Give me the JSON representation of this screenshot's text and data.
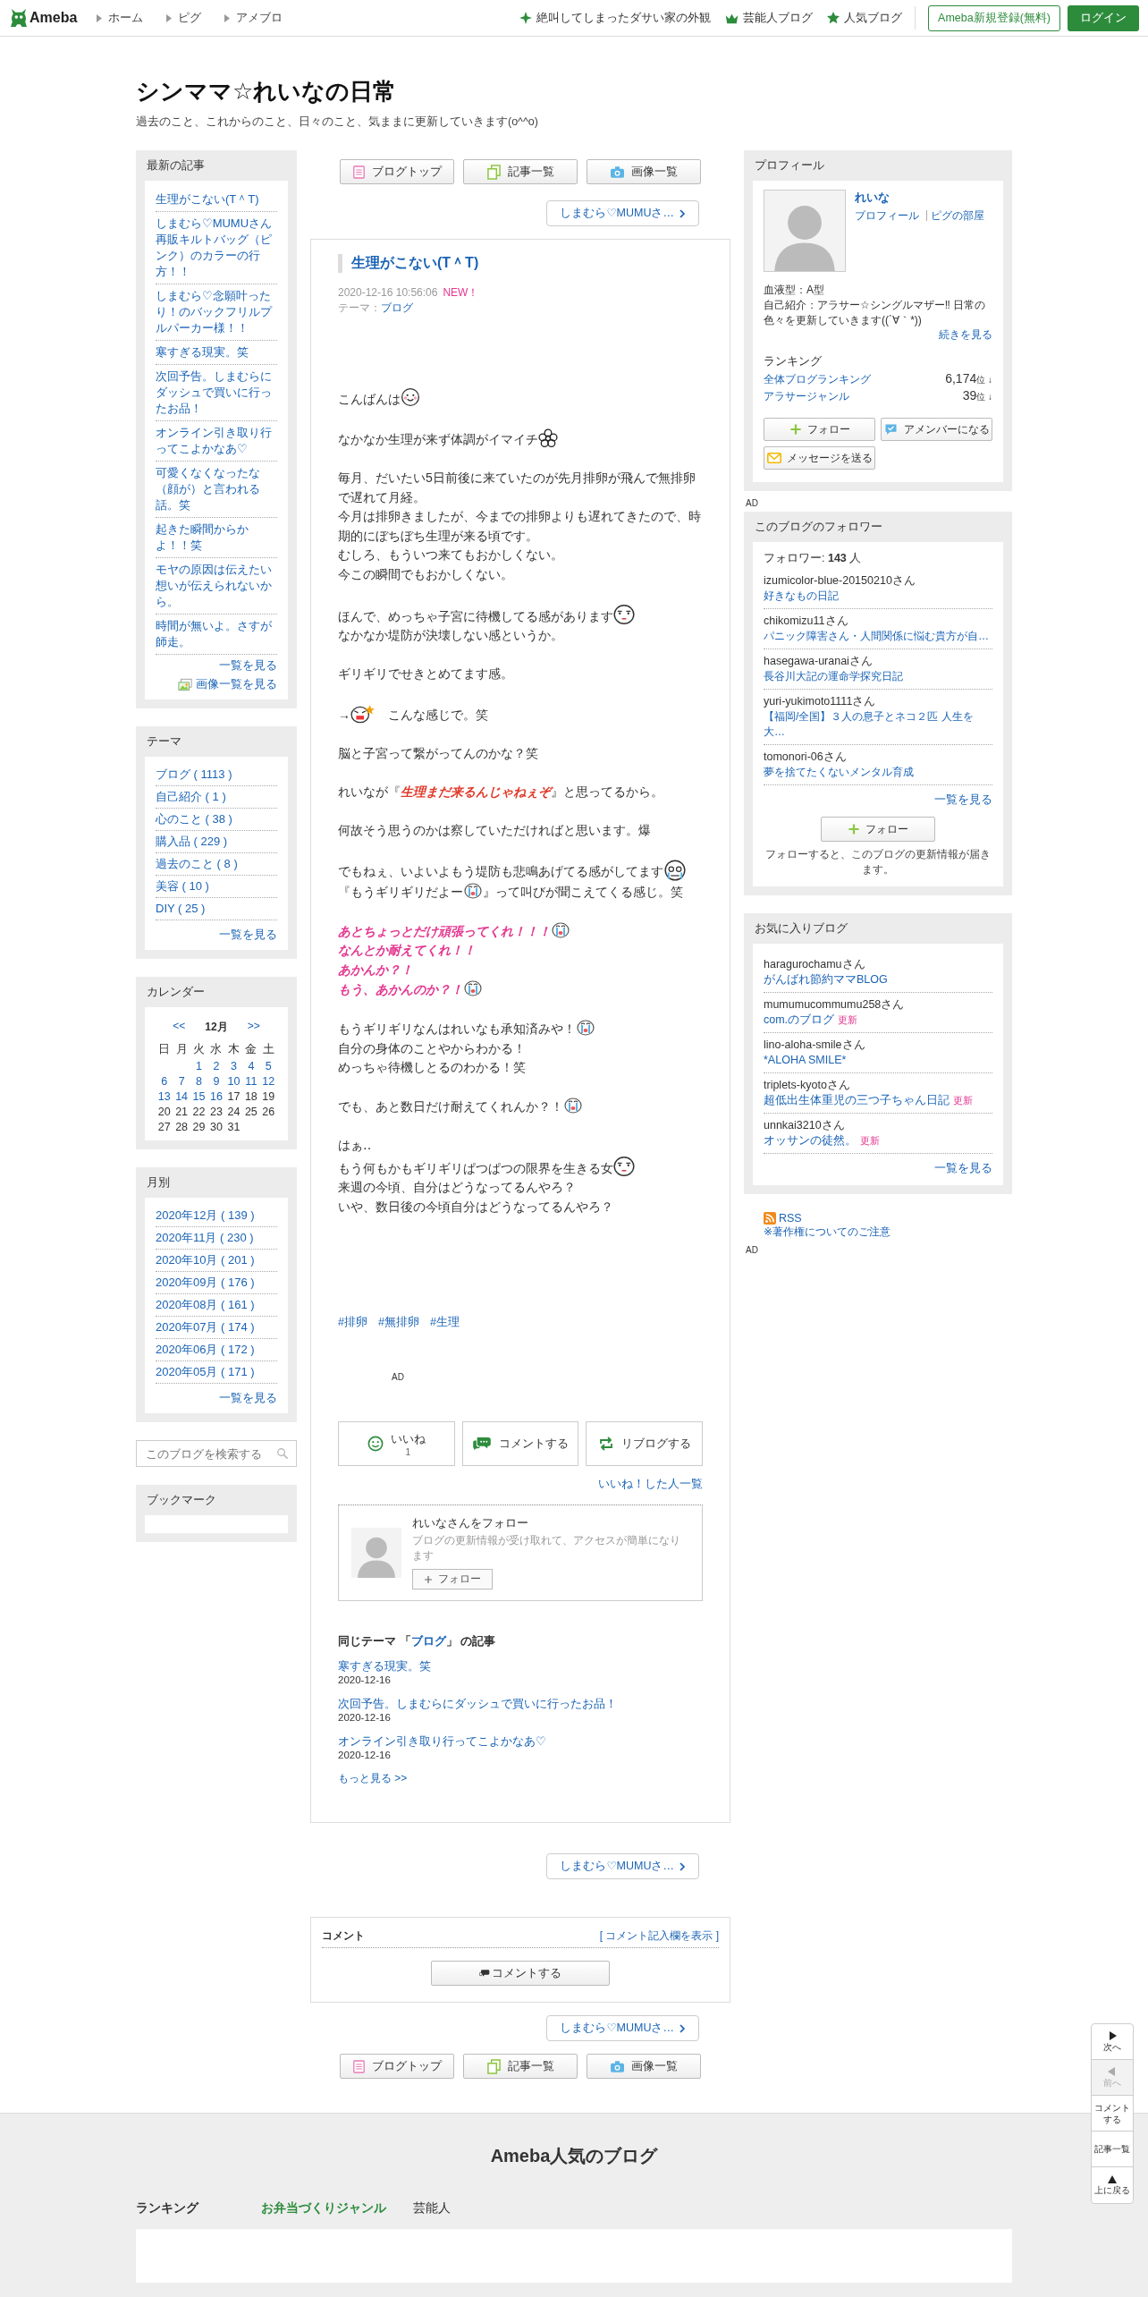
{
  "header": {
    "logo": "Ameba",
    "nav": [
      "ホーム",
      "ピグ",
      "アメブロ"
    ],
    "links": [
      {
        "kind": "sparkle",
        "label": "絶叫してしまったダサい家の外観"
      },
      {
        "kind": "crown",
        "label": "芸能人ブログ"
      },
      {
        "kind": "star",
        "label": "人気ブログ"
      }
    ],
    "register": "Ameba新規登録(無料)",
    "login": "ログイン"
  },
  "blog": {
    "title": "シンママ☆れいなの日常",
    "description": "過去のこと、これからのこと、日々のこと、気ままに更新していきます(o^^o)"
  },
  "left": {
    "recent": {
      "heading": "最新の記事",
      "items": [
        "生理がこない(T＾T)",
        "しまむら♡MUMUさん再販キルトバッグ（ピンク）のカラーの行方！！",
        "しまむら♡念願叶ったり！のバックフリルプルパーカー様！！",
        "寒すぎる現実。笑",
        "次回予告。しまむらにダッシュで買いに行ったお品！",
        "オンライン引き取り行ってこよかなあ♡",
        "可愛くなくなったな（顔が）と言われる話。笑",
        "起きた瞬間からかよ！！笑",
        "モヤの原因は伝えたい想いが伝えられないから。",
        "時間が無いよ。さすが師走。"
      ],
      "more": "一覧を見る",
      "image_more": "画像一覧を見る"
    },
    "themes": {
      "heading": "テーマ",
      "items": [
        "ブログ ( 1113 )",
        "自己紹介 ( 1 )",
        "心のこと ( 38 )",
        "購入品 ( 229 )",
        "過去のこと ( 8 )",
        "美容 ( 10 )",
        "DIY ( 25 )"
      ],
      "more": "一覧を見る"
    },
    "calendar": {
      "heading": "カレンダー",
      "prev": "<<",
      "month": "12月",
      "next": ">>",
      "weekdays": [
        "日",
        "月",
        "火",
        "水",
        "木",
        "金",
        "土"
      ],
      "weeks": [
        [
          {
            "day": "1",
            "linked": true
          },
          {
            "day": "2",
            "linked": true
          },
          {
            "day": "3",
            "linked": true
          },
          {
            "day": "4",
            "linked": true
          },
          {
            "day": "5",
            "linked": true
          }
        ],
        [
          {
            "day": "6",
            "linked": true
          },
          {
            "day": "7",
            "linked": true
          },
          {
            "day": "8",
            "linked": true
          },
          {
            "day": "9",
            "linked": true
          },
          {
            "day": "10",
            "linked": true
          },
          {
            "day": "11",
            "linked": true
          },
          {
            "day": "12",
            "linked": true
          }
        ],
        [
          {
            "day": "13",
            "linked": true
          },
          {
            "day": "14",
            "linked": true
          },
          {
            "day": "15",
            "linked": true
          },
          {
            "day": "16",
            "linked": true
          },
          {
            "day": "17",
            "linked": false
          },
          {
            "day": "18",
            "linked": false
          },
          {
            "day": "19",
            "linked": false
          }
        ],
        [
          {
            "day": "20",
            "linked": false
          },
          {
            "day": "21",
            "linked": false
          },
          {
            "day": "22",
            "linked": false
          },
          {
            "day": "23",
            "linked": false
          },
          {
            "day": "24",
            "linked": false
          },
          {
            "day": "25",
            "linked": false
          },
          {
            "day": "26",
            "linked": false
          }
        ],
        [
          {
            "day": "27",
            "linked": false
          },
          {
            "day": "28",
            "linked": false
          },
          {
            "day": "29",
            "linked": false
          },
          {
            "day": "30",
            "linked": false
          },
          {
            "day": "31",
            "linked": false
          }
        ]
      ]
    },
    "monthly": {
      "heading": "月別",
      "items": [
        "2020年12月 ( 139 )",
        "2020年11月 ( 230 )",
        "2020年10月 ( 201 )",
        "2020年09月 ( 176 )",
        "2020年08月 ( 161 )",
        "2020年07月 ( 174 )",
        "2020年06月 ( 172 )",
        "2020年05月 ( 171 )"
      ],
      "more": "一覧を見る"
    },
    "search": {
      "placeholder": "このブログを検索する"
    },
    "bookmark": {
      "heading": "ブックマーク"
    }
  },
  "center": {
    "top_nav": [
      {
        "kind": "top",
        "label": "ブログトップ"
      },
      {
        "kind": "list",
        "label": "記事一覧"
      },
      {
        "kind": "images",
        "label": "画像一覧"
      }
    ],
    "next_top": "しまむら♡MUMUさ…",
    "article": {
      "title": "生理がこない(T＾T)",
      "date": "2020-12-16 10:56:06",
      "new": "NEW！",
      "theme_label": "テーマ：",
      "theme": "ブログ",
      "paragraphs": [
        [
          {
            "kind": "plain",
            "parts": [
              {
                "text": "こんばんは"
              },
              {
                "kind": "smile"
              }
            ]
          }
        ],
        [
          {
            "kind": "plain",
            "parts": [
              {
                "text": "なかなか生理が来ず体調がイマイチ"
              },
              {
                "kind": "flower"
              }
            ]
          }
        ],
        [
          {
            "kind": "plain",
            "parts": [
              {
                "text": "毎月、だいたい5日前後に来ていたのが先月排卵が飛んで無排卵で遅れて月経。"
              }
            ]
          },
          {
            "kind": "plain",
            "parts": [
              {
                "text": "今月は排卵きましたが、今までの排卵よりも遅れてきたので、時期的にぼちぼち生理が来る頃です。"
              }
            ]
          },
          {
            "kind": "plain",
            "parts": [
              {
                "text": "むしろ、もういつ来てもおかしくない。"
              }
            ]
          },
          {
            "kind": "plain",
            "parts": [
              {
                "text": "今この瞬間でもおかしくない。"
              }
            ]
          }
        ],
        [
          {
            "kind": "plain",
            "parts": [
              {
                "text": "ほんで、めっちゃ子宮に待機してる感があります"
              },
              {
                "kind": "face"
              }
            ]
          },
          {
            "kind": "plain",
            "parts": [
              {
                "text": "なかなか堤防が決壊しない感というか。"
              }
            ]
          }
        ],
        [
          {
            "kind": "plain",
            "parts": [
              {
                "text": "ギリギリでせきとめてます感。"
              }
            ]
          }
        ],
        [
          {
            "kind": "plain",
            "parts": [
              {
                "text": "→"
              },
              {
                "kind": "angry"
              },
              {
                "text": "　こんな感じで。笑"
              }
            ]
          }
        ],
        [
          {
            "kind": "plain",
            "parts": [
              {
                "text": "脳と子宮って繋がってんのかな？笑"
              }
            ]
          }
        ],
        [
          {
            "kind": "plain",
            "parts": [
              {
                "text": "れいなが『**生理まだ来るんじゃねぇぞ**』と思ってるから。"
              }
            ]
          }
        ],
        [
          {
            "kind": "plain",
            "parts": [
              {
                "text": "何故そう思うのかは察していただければと思います。爆"
              }
            ]
          }
        ],
        [
          {
            "kind": "plain",
            "parts": [
              {
                "text": "でもねぇ、いよいよもう堤防も悲鳴あげてる感がしてます"
              },
              {
                "kind": "sweat"
              }
            ]
          },
          {
            "kind": "plain",
            "parts": [
              {
                "text": "『もうギリギリだよー"
              },
              {
                "kind": "cry"
              },
              {
                "text": "』って叫びが聞こえてくる感じ。笑"
              }
            ]
          }
        ],
        [
          {
            "kind": "emphasis",
            "parts": [
              {
                "text": "あとちょっとだけ頑張ってくれ！！！"
              },
              {
                "kind": "cry"
              }
            ]
          },
          {
            "kind": "emphasis",
            "parts": [
              {
                "text": "なんとか耐えてくれ！！"
              }
            ]
          },
          {
            "kind": "emphasis",
            "parts": [
              {
                "text": "あかんか？！"
              }
            ]
          },
          {
            "kind": "emphasis",
            "parts": [
              {
                "text": "もう、あかんのか？！"
              },
              {
                "kind": "cry"
              }
            ]
          }
        ],
        [
          {
            "kind": "plain",
            "parts": [
              {
                "text": "もうギリギリなんはれいなも承知済みや！"
              },
              {
                "kind": "cry"
              }
            ]
          },
          {
            "kind": "plain",
            "parts": [
              {
                "text": "自分の身体のことやからわかる！"
              }
            ]
          },
          {
            "kind": "plain",
            "parts": [
              {
                "text": "めっちゃ待機しとるのわかる！笑"
              }
            ]
          }
        ],
        [
          {
            "kind": "plain",
            "parts": [
              {
                "text": "でも、あと数日だけ耐えてくれんか？！"
              },
              {
                "kind": "cry"
              }
            ]
          }
        ],
        [
          {
            "kind": "plain",
            "parts": [
              {
                "text": "はぁ‥"
              }
            ]
          },
          {
            "kind": "plain",
            "parts": [
              {
                "text": "もう何もかもギリギリぱつぱつの限界を生きる女"
              },
              {
                "kind": "face"
              }
            ]
          },
          {
            "kind": "plain",
            "parts": [
              {
                "text": "来週の今頃、自分はどうなってるんやろ？"
              }
            ]
          },
          {
            "kind": "plain",
            "parts": [
              {
                "text": "いや、数日後の今頃自分はどうなってるんやろ？"
              }
            ]
          }
        ]
      ],
      "hashtags": [
        "#排卵",
        "#無排卵",
        "#生理"
      ],
      "ad": "AD",
      "actions": [
        {
          "kind": "like",
          "label": "いいね",
          "count": "1"
        },
        {
          "kind": "comment",
          "label": "コメントする"
        },
        {
          "kind": "reblog",
          "label": "リブログする"
        }
      ],
      "likers": "いいね！した人一覧",
      "follow_card": {
        "title": "れいなさんをフォロー",
        "note": "ブログの更新情報が受け取れて、アクセスが簡単になります",
        "button": "フォロー"
      },
      "same_theme": {
        "before": "同じテーマ 「",
        "link": "ブログ",
        "after": "」 の記事",
        "entries": [
          {
            "title": "寒すぎる現実。笑",
            "date": "2020-12-16"
          },
          {
            "title": "次回予告。しまむらにダッシュで買いに行ったお品！",
            "date": "2020-12-16"
          },
          {
            "title": "オンライン引き取り行ってこよかなあ♡",
            "date": "2020-12-16"
          }
        ],
        "more": "もっと見る >>"
      }
    },
    "next_middle": "しまむら♡MUMUさ…",
    "comments": {
      "heading": "コメント",
      "show_form": "[ コメント記入欄を表示 ]",
      "button": "コメントする"
    },
    "next_bottom": "しまむら♡MUMUさ…",
    "bottom_nav": [
      {
        "kind": "top",
        "label": "ブログトップ"
      },
      {
        "kind": "list",
        "label": "記事一覧"
      },
      {
        "kind": "images",
        "label": "画像一覧"
      }
    ]
  },
  "right": {
    "profile": {
      "heading": "プロフィール",
      "name": "れいな",
      "links": [
        "プロフィール",
        "ピグの部屋"
      ],
      "blood": "血液型：A型",
      "intro": "自己紹介：アラサー☆シングルマザー‼ 日常の色々を更新していきます((´∀｀*))",
      "intro_more": "続きを見る",
      "ranking_heading": "ランキング",
      "rankings": [
        {
          "label": "全体ブログランキング",
          "value": "6,174",
          "unit": "位",
          "trend": "↓"
        },
        {
          "label": "アラサージャンル",
          "value": "39",
          "unit": "位",
          "trend": "↓"
        }
      ],
      "buttons": [
        {
          "kind": "follow",
          "label": "フォロー"
        },
        {
          "kind": "amember",
          "label": "アメンバーになる"
        },
        {
          "kind": "message",
          "label": "メッセージを送る"
        }
      ]
    },
    "ad": "AD",
    "followers": {
      "heading": "このブログのフォロワー",
      "count_text": "フォロワー: **143** 人",
      "items": [
        {
          "user": "izumicolor-blue-20150210さん",
          "blog": "好きなもの日記"
        },
        {
          "user": "chikomizu11さん",
          "blog": "パニック障害さん・人間関係に悩む貴方が自…"
        },
        {
          "user": "hasegawa-uranaiさん",
          "blog": "長谷川大記の運命学探究日記"
        },
        {
          "user": "yuri-yukimoto1111さん",
          "blog": "【福岡/全国】３人の息子とネコ２匹 人生を大…"
        },
        {
          "user": "tomonori-06さん",
          "blog": "夢を捨てたくないメンタル育成"
        }
      ],
      "more": "一覧を見る",
      "button": "フォロー",
      "note": "フォローすると、このブログの更新情報が届きます。"
    },
    "favorites": {
      "heading": "お気に入りブログ",
      "items": [
        {
          "user": "haragurochamuさん",
          "blog": "がんばれ節約ママBLOG"
        },
        {
          "user": "mumumucommumu258さん",
          "blog": "com.のブログ",
          "badge": "更新"
        },
        {
          "user": "lino-aloha-smileさん",
          "blog": "*ALOHA SMILE*"
        },
        {
          "user": "triplets-kyotoさん",
          "blog": "超低出生体重児の三つ子ちゃん日記",
          "badge": "更新"
        },
        {
          "user": "unnkai3210さん",
          "blog": "オッサンの徒然。",
          "badge": "更新"
        }
      ],
      "more": "一覧を見る"
    },
    "rss": "RSS",
    "copyright": "※著作権についてのご注意",
    "ad_bottom": "AD"
  },
  "side_nav": [
    {
      "kind": "next",
      "label": "次へ",
      "disabled": false
    },
    {
      "kind": "prev",
      "label": "前へ",
      "disabled": true
    },
    {
      "kind": "comment",
      "label": "コメントする",
      "disabled": false
    },
    {
      "kind": "list",
      "label": "記事一覧",
      "disabled": false
    },
    {
      "kind": "top",
      "label": "上に戻る",
      "disabled": false
    }
  ],
  "footer": {
    "title": "Ameba人気のブログ",
    "ranking_label": "ランキング",
    "tabs": [
      {
        "label": "お弁当づくりジャンル",
        "selected": true
      },
      {
        "label": "芸能人",
        "selected": false
      }
    ]
  }
}
